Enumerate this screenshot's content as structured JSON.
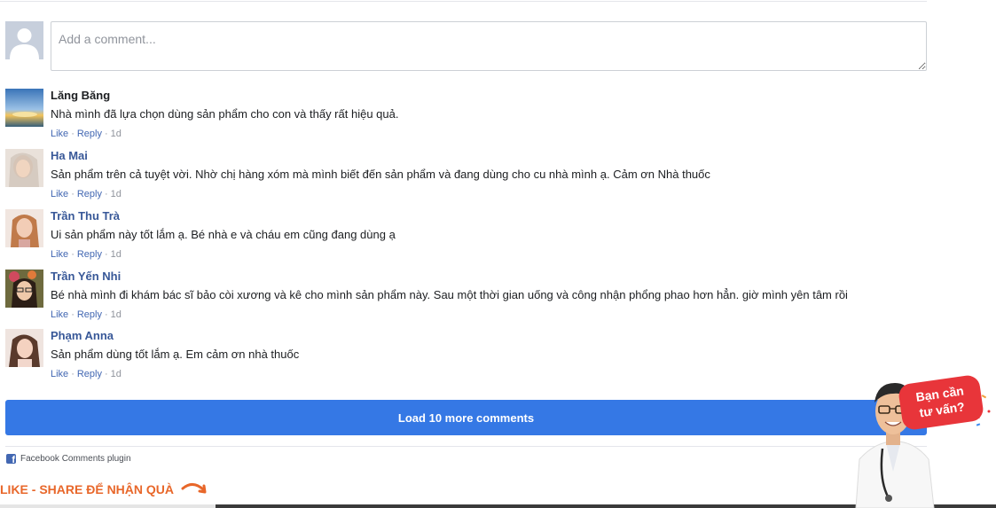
{
  "composer": {
    "placeholder": "Add a comment..."
  },
  "comments": [
    {
      "author": "Lăng Băng",
      "text": "Nhà mình đã lựa chọn dùng sản phẩm cho con và thấy rất hiệu quả.",
      "like": "Like",
      "reply": "Reply",
      "time": "1d"
    },
    {
      "author": "Ha Mai",
      "text": "Sản phẩm trên cả tuyệt vời. Nhờ chị hàng xóm mà mình biết đến sản phẩm và đang dùng cho cu nhà mình ạ. Cảm ơn Nhà thuốc",
      "like": "Like",
      "reply": "Reply",
      "time": "1d"
    },
    {
      "author": "Trần Thu Trà",
      "text": "Ui sản phẩm này tốt lắm ạ. Bé nhà e và cháu em cũng đang dùng ạ",
      "like": "Like",
      "reply": "Reply",
      "time": "1d"
    },
    {
      "author": "Trần Yến Nhi",
      "text": "Bé nhà mình đi khám bác sĩ bảo còi xương và kê cho mình sản phẩm này. Sau một thời gian uống và công nhận phổng phao hơn hẳn. giờ mình yên tâm rồi",
      "like": "Like",
      "reply": "Reply",
      "time": "1d"
    },
    {
      "author": "Phạm Anna",
      "text": "Sản phẩm dùng tốt lắm ạ. Em cảm ơn nhà thuốc",
      "like": "Like",
      "reply": "Reply",
      "time": "1d"
    }
  ],
  "load_more_label": "Load 10 more comments",
  "plugin_label": "Facebook Comments plugin",
  "promo_label": "LIKE - SHARE ĐỂ NHẬN QUÀ",
  "consult": {
    "line1": "Bạn cần",
    "line2": "tư vấn?"
  },
  "colors": {
    "link": "#385898",
    "action": "#4267b2",
    "button": "#3578e5",
    "promo": "#e8672a",
    "bubble": "#e8353a"
  }
}
